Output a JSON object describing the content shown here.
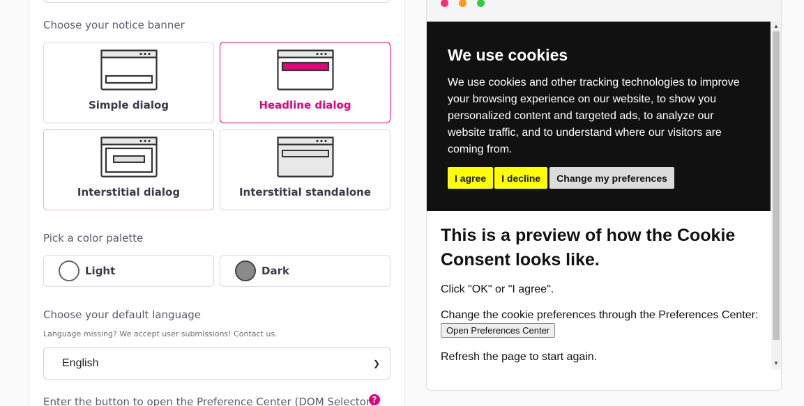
{
  "form": {
    "banner_label": "Choose your notice banner",
    "banner_options": [
      {
        "label": "Simple dialog"
      },
      {
        "label": "Headline dialog"
      },
      {
        "label": "Interstitial dialog"
      },
      {
        "label": "Interstitial standalone"
      }
    ],
    "selected_banner": "Headline dialog",
    "palette_label": "Pick a color palette",
    "palette_options": [
      {
        "label": "Light"
      },
      {
        "label": "Dark"
      }
    ],
    "language_label": "Choose your default language",
    "language_note": "Language missing? We accept user submissions! Contact us.",
    "language_value": "English",
    "dom_selector_label": "Enter the button to open the Preference Center (DOM Selector)",
    "help_icon": "?"
  },
  "preview": {
    "cookie_title": "We use cookies",
    "cookie_text": "We use cookies and other tracking technologies to improve your browsing experience on our website, to show you personalized content and targeted ads, to analyze our website traffic, and to understand where our visitors are coming from.",
    "btn_agree": "I agree",
    "btn_decline": "I decline",
    "btn_prefs": "Change my preferences",
    "heading": "This is a preview of how the Cookie Consent looks like.",
    "p1": "Click \"OK\" or \"I agree\".",
    "p2": "Change the cookie preferences through the Preferences Center:",
    "open_prefs_btn": "Open Preferences Center",
    "p3": "Refresh the page to start again."
  },
  "colors": {
    "accent": "#e6007e",
    "cookie_bg": "#111111",
    "button_yellow": "#ffff00"
  }
}
